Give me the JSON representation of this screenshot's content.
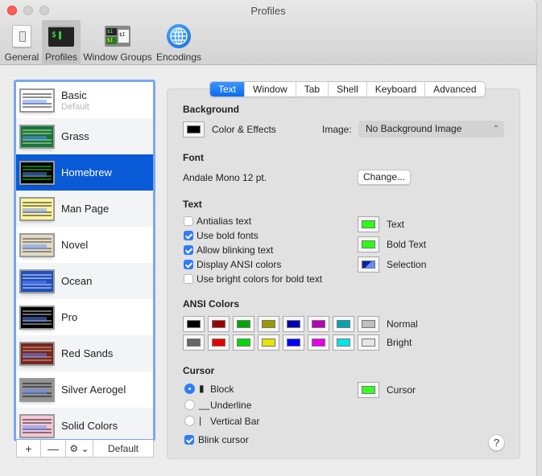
{
  "window": {
    "title": "Profiles"
  },
  "toolbar": {
    "items": [
      {
        "label": "General",
        "icon": "general-switch-icon",
        "active": false
      },
      {
        "label": "Profiles",
        "icon": "terminal-icon",
        "active": true
      },
      {
        "label": "Window Groups",
        "icon": "window-groups-icon",
        "active": false
      },
      {
        "label": "Encodings",
        "icon": "globe-icon",
        "active": false
      }
    ],
    "profiles_icon_text": "$",
    "wg_icon_texts": [
      "$I",
      "$I",
      "$I"
    ]
  },
  "profiles": {
    "selected": "Homebrew",
    "items": [
      {
        "name": "Basic",
        "subtitle": "Default",
        "bg": "#ffffff",
        "fg": "#000000"
      },
      {
        "name": "Grass",
        "subtitle": "",
        "bg": "#13773d",
        "fg": "#fff0a5"
      },
      {
        "name": "Homebrew",
        "subtitle": "",
        "bg": "#000000",
        "fg": "#28fe14"
      },
      {
        "name": "Man Page",
        "subtitle": "",
        "bg": "#fef49c",
        "fg": "#000000"
      },
      {
        "name": "Novel",
        "subtitle": "",
        "bg": "#dfdbc3",
        "fg": "#3b2322"
      },
      {
        "name": "Ocean",
        "subtitle": "",
        "bg": "#224fbc",
        "fg": "#ffffff"
      },
      {
        "name": "Pro",
        "subtitle": "",
        "bg": "#000000",
        "fg": "#f2f2f2"
      },
      {
        "name": "Red Sands",
        "subtitle": "",
        "bg": "#7a251e",
        "fg": "#d7c9a7"
      },
      {
        "name": "Silver Aerogel",
        "subtitle": "",
        "bg": "#929292",
        "fg": "#000000"
      },
      {
        "name": "Solid Colors",
        "subtitle": "",
        "bg": "#f4c6d4",
        "fg": "#000000"
      }
    ],
    "tools": {
      "add": "+",
      "remove": "—",
      "gear": "⚙ ⌄",
      "default": "Default"
    }
  },
  "tabs": {
    "active": "Text",
    "items": [
      "Text",
      "Window",
      "Tab",
      "Shell",
      "Keyboard",
      "Advanced"
    ]
  },
  "background": {
    "title": "Background",
    "color_effects_label": "Color & Effects",
    "color": "#000000",
    "image_label": "Image:",
    "image_value": "No Background Image"
  },
  "font": {
    "title": "Font",
    "value": "Andale Mono 12 pt.",
    "change_label": "Change..."
  },
  "text": {
    "title": "Text",
    "options": [
      {
        "label": "Antialias text",
        "checked": false
      },
      {
        "label": "Use bold fonts",
        "checked": true
      },
      {
        "label": "Allow blinking text",
        "checked": true
      },
      {
        "label": "Display ANSI colors",
        "checked": true
      },
      {
        "label": "Use bright colors for bold text",
        "checked": false
      }
    ],
    "colors": [
      {
        "label": "Text",
        "color": "#28fe14"
      },
      {
        "label": "Bold Text",
        "color": "#28fe14"
      },
      {
        "label": "Selection",
        "color": "#0b22a0",
        "color2": "#6a8cff"
      }
    ]
  },
  "ansi": {
    "title": "ANSI Colors",
    "normal_label": "Normal",
    "bright_label": "Bright",
    "normal": [
      "#000000",
      "#990000",
      "#00a600",
      "#999900",
      "#0000b2",
      "#b200b2",
      "#00a6b2",
      "#bfbfbf"
    ],
    "bright": [
      "#666666",
      "#e50000",
      "#00d900",
      "#e5e500",
      "#0000ff",
      "#e500e5",
      "#00e5e5",
      "#e5e5e5"
    ]
  },
  "cursor": {
    "title": "Cursor",
    "styles": [
      {
        "label": "Block",
        "glyph": "▮",
        "selected": true
      },
      {
        "label": "Underline",
        "glyph": "__",
        "selected": false
      },
      {
        "label": "Vertical Bar",
        "glyph": "|",
        "selected": false
      }
    ],
    "blink_label": "Blink cursor",
    "blink": true,
    "color_label": "Cursor",
    "color": "#38fe27"
  },
  "help_label": "?"
}
